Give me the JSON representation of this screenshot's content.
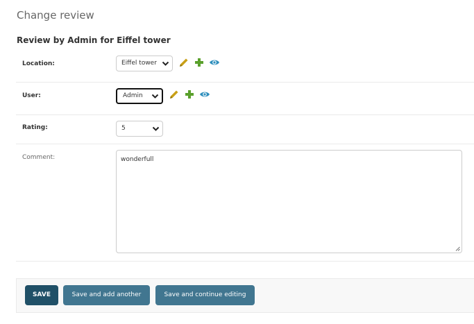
{
  "page": {
    "title": "Change review",
    "form_heading": "Review by Admin for Eiffel tower"
  },
  "fields": {
    "location": {
      "label": "Location:",
      "value": "Eiffel tower"
    },
    "user": {
      "label": "User:",
      "value": "Admin"
    },
    "rating": {
      "label": "Rating:",
      "value": "5"
    },
    "comment": {
      "label": "Comment:",
      "value": "wonderfull"
    }
  },
  "actions": {
    "icons": [
      "pencil-icon",
      "plus-icon",
      "eye-icon"
    ]
  },
  "buttons": {
    "save": "SAVE",
    "save_add_another": "Save and add another",
    "save_continue": "Save and continue editing"
  },
  "colors": {
    "save_button": "#205067",
    "secondary_button": "#417690",
    "pencil": "#c9a017",
    "plus": "#5aa02c",
    "eye": "#2f8fbd"
  }
}
